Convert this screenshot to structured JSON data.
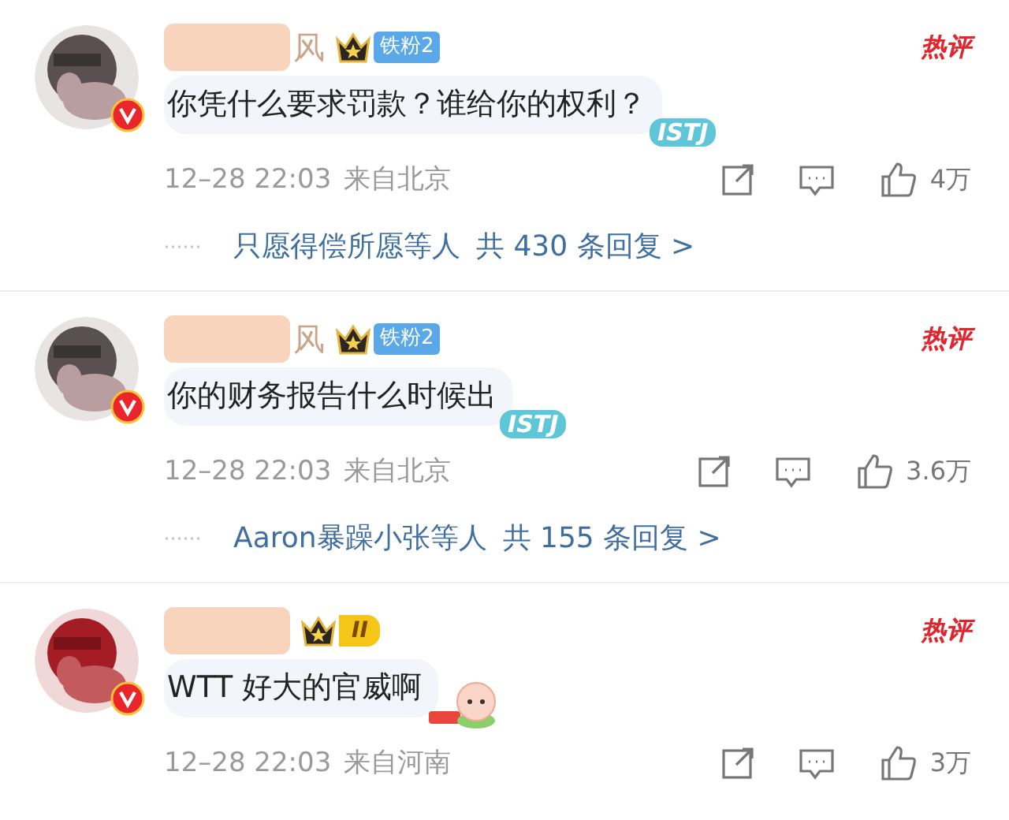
{
  "comments": [
    {
      "name": "风",
      "badge": {
        "kind": "fan",
        "text": "铁粉2"
      },
      "verified": true,
      "text": "你凭什么要求罚款？谁给你的权利？",
      "sticker": {
        "kind": "istj",
        "text": "ISTJ"
      },
      "hot_tag": "热评",
      "time": "12–28 22:03",
      "location": "来自北京",
      "likes": "4万",
      "replies": {
        "users": "只愿得偿所愿等人",
        "count": "共 430 条回复 >"
      }
    },
    {
      "name": "风",
      "badge": {
        "kind": "fan",
        "text": "铁粉2"
      },
      "verified": true,
      "text": "你的财务报告什么时候出",
      "sticker": {
        "kind": "istj",
        "text": "ISTJ"
      },
      "hot_tag": "热评",
      "time": "12–28 22:03",
      "location": "来自北京",
      "likes": "3.6万",
      "replies": {
        "users": "Aaron暴躁小张等人",
        "count": "共 155 条回复 >"
      }
    },
    {
      "badge": {
        "kind": "level",
        "text": "II"
      },
      "verified": true,
      "text": "WTT 好大的官威啊",
      "sticker": {
        "kind": "peach"
      },
      "hot_tag": "热评",
      "time": "12–28 22:03",
      "location": "来自河南",
      "likes": "3万"
    }
  ]
}
